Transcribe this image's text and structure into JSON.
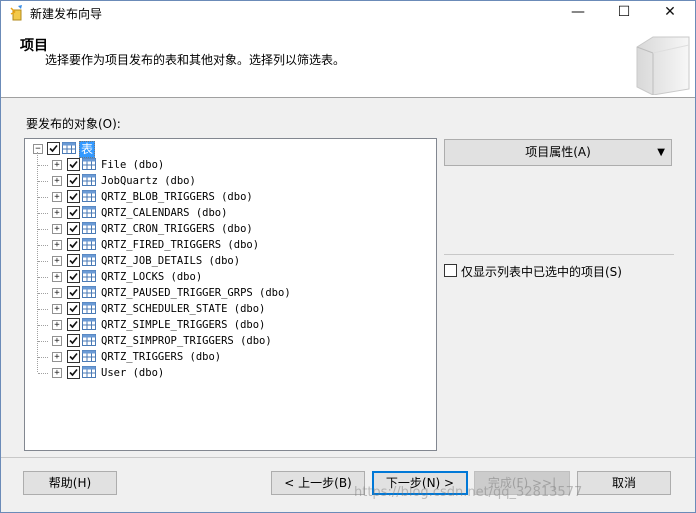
{
  "window": {
    "title": "新建发布向导",
    "controls": {
      "minimize": "—",
      "maximize": "☐",
      "close": "✕"
    }
  },
  "header": {
    "title": "项目",
    "subtitle": "选择要作为项目发布的表和其他对象。选择列以筛选表。"
  },
  "objects_label": "要发布的对象(O):",
  "tree": {
    "root_label": "表",
    "items": [
      {
        "label": "File (dbo)",
        "checked": true
      },
      {
        "label": "JobQuartz (dbo)",
        "checked": true
      },
      {
        "label": "QRTZ_BLOB_TRIGGERS (dbo)",
        "checked": true
      },
      {
        "label": "QRTZ_CALENDARS (dbo)",
        "checked": true
      },
      {
        "label": "QRTZ_CRON_TRIGGERS (dbo)",
        "checked": true
      },
      {
        "label": "QRTZ_FIRED_TRIGGERS (dbo)",
        "checked": true
      },
      {
        "label": "QRTZ_JOB_DETAILS (dbo)",
        "checked": true
      },
      {
        "label": "QRTZ_LOCKS (dbo)",
        "checked": true
      },
      {
        "label": "QRTZ_PAUSED_TRIGGER_GRPS (dbo)",
        "checked": true
      },
      {
        "label": "QRTZ_SCHEDULER_STATE (dbo)",
        "checked": true
      },
      {
        "label": "QRTZ_SIMPLE_TRIGGERS (dbo)",
        "checked": true
      },
      {
        "label": "QRTZ_SIMPROP_TRIGGERS (dbo)",
        "checked": true
      },
      {
        "label": "QRTZ_TRIGGERS (dbo)",
        "checked": true
      },
      {
        "label": "User (dbo)",
        "checked": true
      }
    ]
  },
  "item_properties_button": "项目属性(A)",
  "dropdown_arrow": "▼",
  "show_only_checked": {
    "label": "仅显示列表中已选中的项目(S)",
    "checked": false
  },
  "buttons": {
    "help": "帮助(H)",
    "back": "< 上一步(B)",
    "next": "下一步(N) >",
    "finish": "完成(F) >>|",
    "cancel": "取消"
  },
  "watermark": "https://blog.csdn.net/qq_32813577"
}
